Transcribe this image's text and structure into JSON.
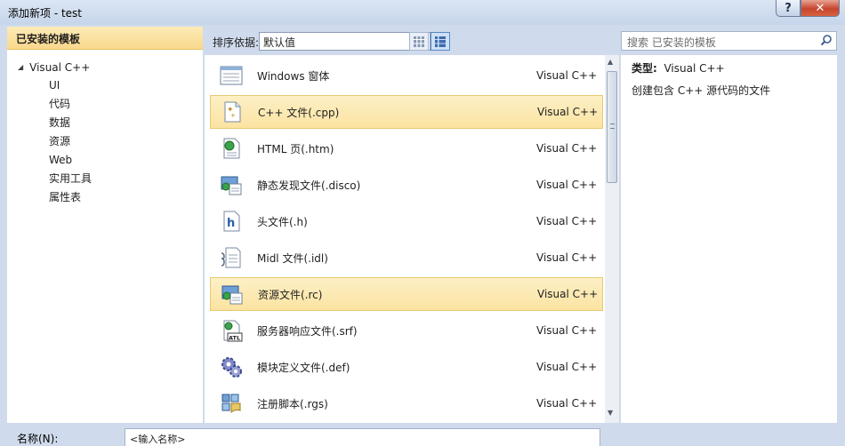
{
  "window": {
    "title": "添加新项 - test",
    "help": "?",
    "close": "✕"
  },
  "left": {
    "header": "已安装的模板",
    "root": "Visual C++",
    "children": [
      "UI",
      "代码",
      "数据",
      "资源",
      "Web",
      "实用工具",
      "属性表"
    ]
  },
  "toolbar": {
    "sort_label": "排序依据:",
    "sort_value": "默认值"
  },
  "items": [
    {
      "name": "Windows 窗体",
      "type": "Visual C++",
      "icon": "form-icon"
    },
    {
      "name": "C++ 文件(.cpp)",
      "type": "Visual C++",
      "icon": "cpp-file-icon"
    },
    {
      "name": "HTML 页(.htm)",
      "type": "Visual C++",
      "icon": "html-page-icon"
    },
    {
      "name": "静态发现文件(.disco)",
      "type": "Visual C++",
      "icon": "disco-file-icon"
    },
    {
      "name": "头文件(.h)",
      "type": "Visual C++",
      "icon": "header-file-icon"
    },
    {
      "name": "Midl 文件(.idl)",
      "type": "Visual C++",
      "icon": "midl-file-icon"
    },
    {
      "name": "资源文件(.rc)",
      "type": "Visual C++",
      "icon": "resource-file-icon"
    },
    {
      "name": "服务器响应文件(.srf)",
      "type": "Visual C++",
      "icon": "atl-srf-icon"
    },
    {
      "name": "模块定义文件(.def)",
      "type": "Visual C++",
      "icon": "def-file-icon"
    },
    {
      "name": "注册脚本(.rgs)",
      "type": "Visual C++",
      "icon": "rgs-script-icon"
    }
  ],
  "search": {
    "placeholder": "搜索 已安装的模板"
  },
  "details": {
    "type_label": "类型:",
    "type_value": "Visual C++",
    "description": "创建包含 C++ 源代码的文件"
  },
  "bottom": {
    "name_label": "名称(N):",
    "name_value": "<输入名称>"
  },
  "colors": {
    "selection": "#fbe3a1",
    "header": "#f9d88c",
    "chrome": "#cfdbec"
  }
}
